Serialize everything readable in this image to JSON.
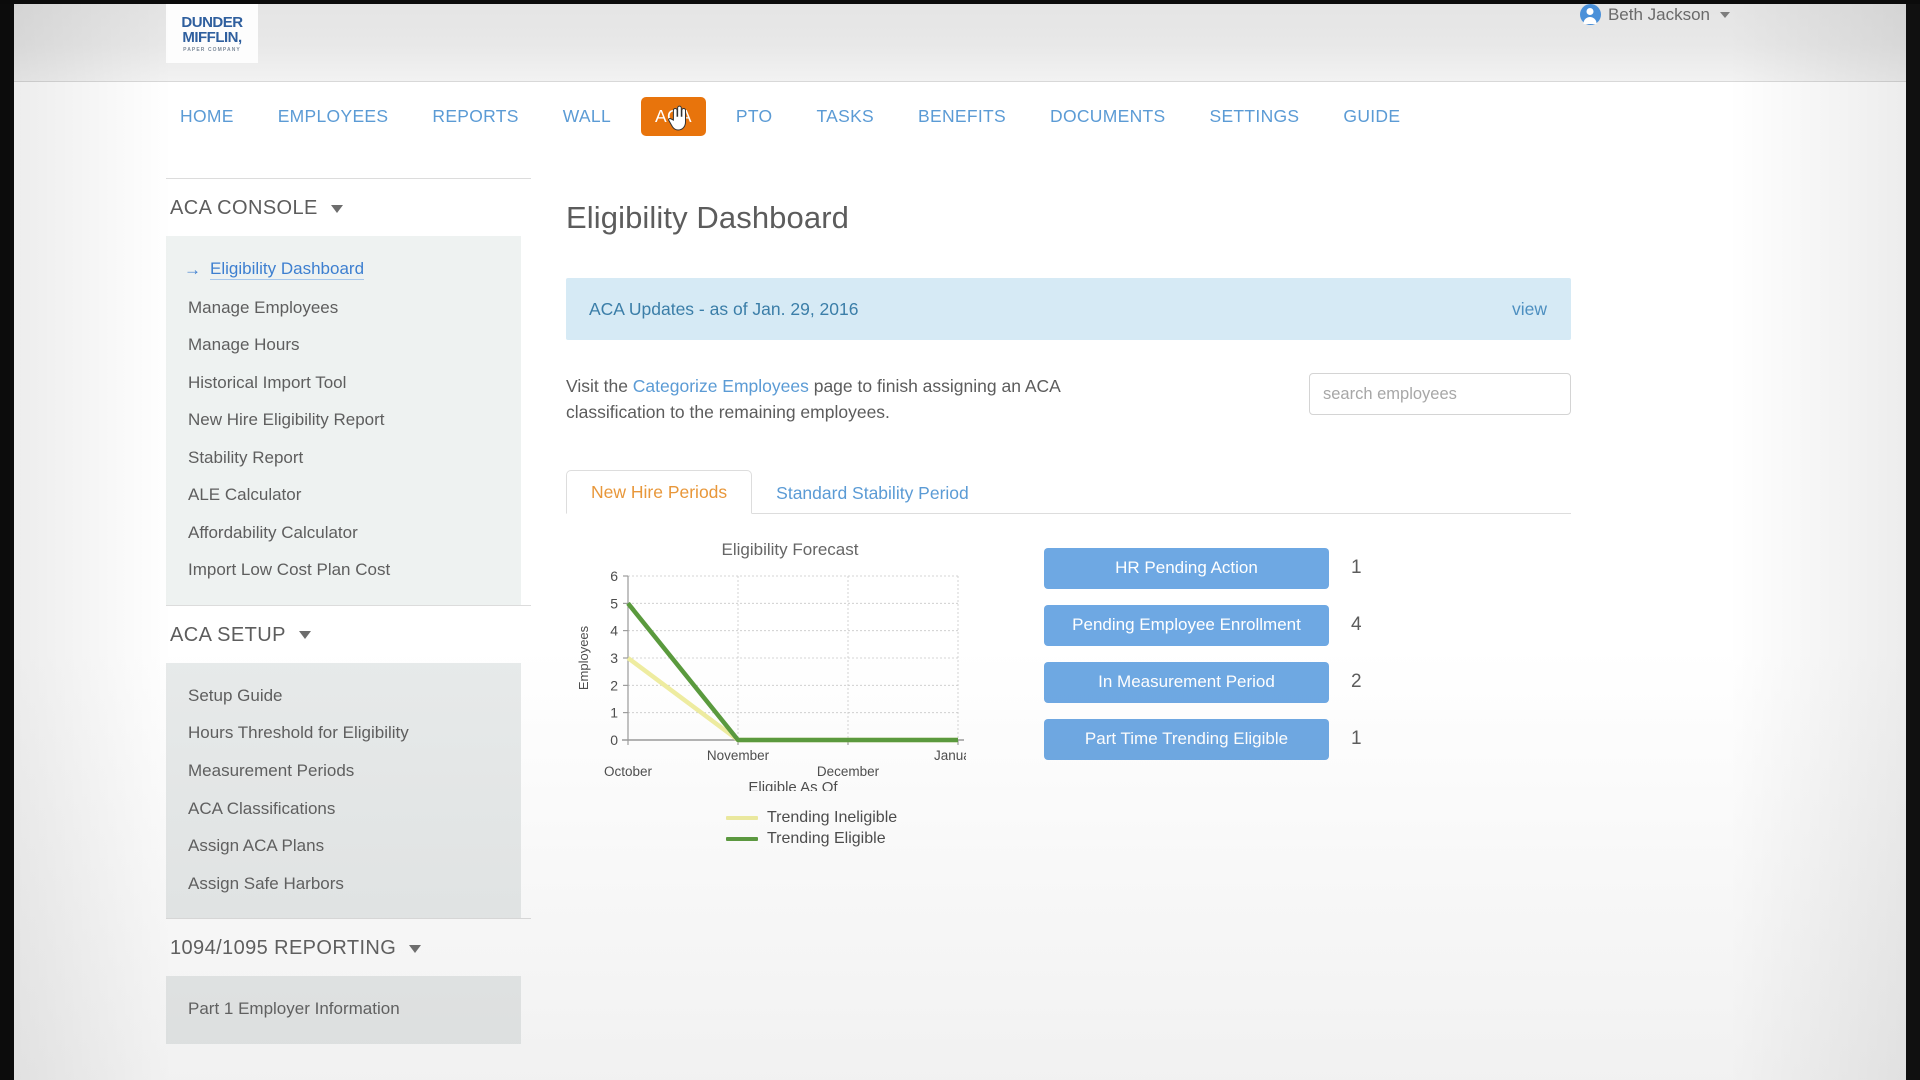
{
  "topbar": {
    "logo": {
      "line1": "DUNDER",
      "line2": "MIFFLIN,",
      "sub": "PAPER COMPANY"
    },
    "user": {
      "name": "Beth Jackson"
    }
  },
  "nav": {
    "items": [
      {
        "label": "HOME",
        "active": false
      },
      {
        "label": "EMPLOYEES",
        "active": false
      },
      {
        "label": "REPORTS",
        "active": false
      },
      {
        "label": "WALL",
        "active": false
      },
      {
        "label": "ACA",
        "active": true
      },
      {
        "label": "PTO",
        "active": false
      },
      {
        "label": "TASKS",
        "active": false
      },
      {
        "label": "BENEFITS",
        "active": false
      },
      {
        "label": "DOCUMENTS",
        "active": false
      },
      {
        "label": "SETTINGS",
        "active": false
      },
      {
        "label": "GUIDE",
        "active": false
      }
    ]
  },
  "sidebar": {
    "sections": [
      {
        "title": "ACA CONSOLE",
        "items": [
          {
            "label": "Eligibility Dashboard",
            "active": true
          },
          {
            "label": "Manage Employees",
            "active": false
          },
          {
            "label": "Manage Hours",
            "active": false
          },
          {
            "label": "Historical Import Tool",
            "active": false
          },
          {
            "label": "New Hire Eligibility Report",
            "active": false
          },
          {
            "label": "Stability Report",
            "active": false
          },
          {
            "label": "ALE Calculator",
            "active": false
          },
          {
            "label": "Affordability Calculator",
            "active": false
          },
          {
            "label": "Import Low Cost Plan Cost",
            "active": false
          }
        ]
      },
      {
        "title": "ACA SETUP",
        "items": [
          {
            "label": "Setup Guide",
            "active": false
          },
          {
            "label": "Hours Threshold for Eligibility",
            "active": false
          },
          {
            "label": "Measurement Periods",
            "active": false
          },
          {
            "label": "ACA Classifications",
            "active": false
          },
          {
            "label": "Assign ACA Plans",
            "active": false
          },
          {
            "label": "Assign Safe Harbors",
            "active": false
          }
        ]
      },
      {
        "title": "1094/1095 REPORTING",
        "items": [
          {
            "label": "Part 1 Employer Information",
            "active": false
          }
        ]
      }
    ]
  },
  "main": {
    "page_title": "Eligibility Dashboard",
    "alert": {
      "text": "ACA Updates - as of Jan. 29, 2016",
      "link": "view"
    },
    "note": {
      "before": "Visit the ",
      "link": "Categorize Employees",
      "after": " page to finish assigning an ACA classification to the remaining employees."
    },
    "search": {
      "placeholder": "search employees",
      "value": ""
    },
    "tabs": [
      {
        "label": "New Hire Periods",
        "active": true
      },
      {
        "label": "Standard Stability Period",
        "active": false
      }
    ],
    "statuses": [
      {
        "label": "HR Pending Action",
        "count": "1"
      },
      {
        "label": "Pending Employee Enrollment",
        "count": "4"
      },
      {
        "label": "In Measurement Period",
        "count": "2"
      },
      {
        "label": "Part Time Trending Eligible",
        "count": "1"
      }
    ]
  },
  "chart_data": {
    "type": "line",
    "title": "Eligibility Forecast",
    "xlabel": "Eligible As Of",
    "ylabel": "Employees",
    "categories": [
      "October",
      "November",
      "December",
      "January"
    ],
    "ylim": [
      0,
      6
    ],
    "yticks": [
      0,
      1,
      2,
      3,
      4,
      5,
      6
    ],
    "grid": true,
    "legend_position": "bottom",
    "series": [
      {
        "name": "Trending Ineligible",
        "color": "#efeda0",
        "values": [
          3,
          0,
          0,
          0
        ]
      },
      {
        "name": "Trending Eligible",
        "color": "#5a9a3d",
        "values": [
          5,
          0,
          0,
          0
        ]
      }
    ]
  },
  "colors": {
    "accent_orange": "#e8740c",
    "link_blue": "#5b9bd5",
    "button_blue": "#6ea8e3",
    "alert_bg": "#d6eaf5",
    "sidebar_bg": "#eef2f1"
  }
}
